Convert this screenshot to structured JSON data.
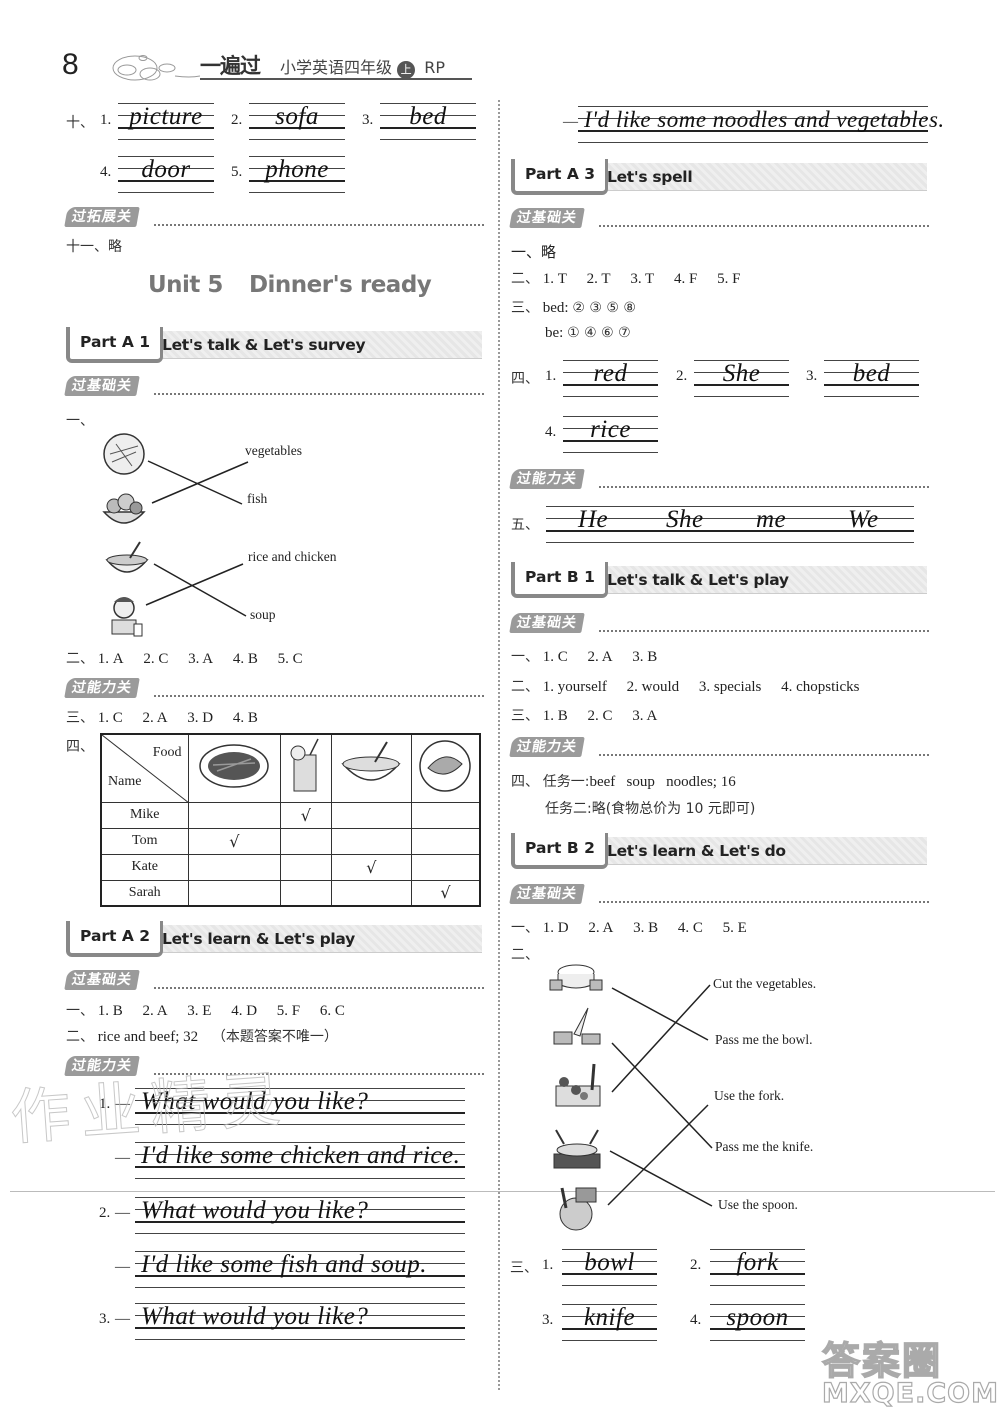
{
  "header": {
    "page_number": "8",
    "brand": "一遍过",
    "book_title": "小学英语四年级",
    "volume_badge": "上",
    "edition": "RP"
  },
  "left": {
    "q10": {
      "label": "十、",
      "items": [
        {
          "num": "1.",
          "word": "picture"
        },
        {
          "num": "2.",
          "word": "sofa"
        },
        {
          "num": "3.",
          "word": "bed"
        },
        {
          "num": "4.",
          "word": "door"
        },
        {
          "num": "5.",
          "word": "phone"
        }
      ]
    },
    "level_extend": "过拓展关",
    "q11": {
      "label": "十一、",
      "text": "略"
    },
    "unit_title": {
      "unit": "Unit 5",
      "name": "Dinner's ready"
    },
    "partA1": {
      "tab": "Part A 1",
      "title": "Let's talk & Let's survey",
      "level_basic": "过基础关",
      "q1_label": "一、",
      "match_pictures": [
        "fish-dish-picture",
        "vegetable-basket-picture",
        "soup-bowl-picture",
        "boy-eating-picture"
      ],
      "match_words": [
        "vegetables",
        "fish",
        "rice and chicken",
        "soup"
      ],
      "q2": {
        "label": "二、",
        "answers": [
          "1. A",
          "2. C",
          "3. A",
          "4. B",
          "5. C"
        ]
      },
      "level_ability": "过能力关",
      "q3": {
        "label": "三、",
        "answers": [
          "1. C",
          "2. A",
          "3. D",
          "4. B"
        ]
      },
      "q4": {
        "label": "四、",
        "corner_food": "Food",
        "corner_name": "Name",
        "food_pictures": [
          "noodles-plate-picture",
          "juice-glass-picture",
          "soup-bowl-picture",
          "fish-plate-picture"
        ],
        "rows": [
          {
            "name": "Mike",
            "checks": [
              "",
              "√",
              "",
              ""
            ]
          },
          {
            "name": "Tom",
            "checks": [
              "√",
              "",
              "",
              ""
            ]
          },
          {
            "name": "Kate",
            "checks": [
              "",
              "",
              "√",
              ""
            ]
          },
          {
            "name": "Sarah",
            "checks": [
              "",
              "",
              "",
              "√"
            ]
          }
        ]
      }
    },
    "partA2": {
      "tab": "Part A 2",
      "title": "Let's learn  & Let's play",
      "level_basic": "过基础关",
      "q1": {
        "label": "一、",
        "answers": [
          "1. B",
          "2. A",
          "3. E",
          "4. D",
          "5. F",
          "6. C"
        ]
      },
      "q2": {
        "label": "二、",
        "text": "rice and beef; 32",
        "note": "（本题答案不唯一）"
      },
      "level_ability": "过能力关",
      "dialogues": [
        {
          "num": "1.",
          "q": "What would you like?",
          "a": "I'd like some chicken and rice."
        },
        {
          "num": "2.",
          "q": "What would you like?",
          "a": "I'd like some fish and soup."
        },
        {
          "num": "3.",
          "q": "What would you like?",
          "a": "I'd like some noodles and vegetables."
        }
      ],
      "dash": "—"
    }
  },
  "right": {
    "partA3": {
      "tab": "Part A 3",
      "title": "Let's spell",
      "level_basic": "过基础关",
      "q1": {
        "label": "一、",
        "text": "略"
      },
      "q2": {
        "label": "二、",
        "answers": [
          "1. T",
          "2. T",
          "3. T",
          "4. F",
          "5. F"
        ]
      },
      "q3": {
        "label": "三、",
        "bed_label": "bed:",
        "bed_answers": "② ③ ⑤ ⑧",
        "be_label": "be:",
        "be_answers": "① ④ ⑥ ⑦"
      },
      "q4": {
        "label": "四、",
        "items": [
          {
            "num": "1.",
            "word": "red"
          },
          {
            "num": "2.",
            "word": "She"
          },
          {
            "num": "3.",
            "word": "bed"
          },
          {
            "num": "4.",
            "word": "rice"
          }
        ]
      },
      "level_ability": "过能力关",
      "q5": {
        "label": "五、",
        "words": [
          "He",
          "She",
          "me",
          "We"
        ]
      }
    },
    "partB1": {
      "tab": "Part B 1",
      "title": "Let's talk & Let's play",
      "level_basic": "过基础关",
      "q1": {
        "label": "一、",
        "answers": [
          "1. C",
          "2. A",
          "3. B"
        ]
      },
      "q2": {
        "label": "二、",
        "answers": [
          "1. yourself",
          "2. would",
          "3. specials",
          "4. chopsticks"
        ]
      },
      "q3": {
        "label": "三、",
        "answers": [
          "1. B",
          "2. C",
          "3. A"
        ]
      },
      "level_ability": "过能力关",
      "q4": {
        "label": "四、",
        "task1_label": "任务一:",
        "task1": "beef   soup   noodles; 16",
        "task2_label": "任务二:",
        "task2": "略(食物总价为 10 元即可)"
      }
    },
    "partB2": {
      "tab": "Part B 2",
      "title": "Let's learn  & Let's do",
      "level_basic": "过基础关",
      "q1": {
        "label": "一、",
        "answers": [
          "1. D",
          "2. A",
          "3. B",
          "4. C",
          "5. E"
        ]
      },
      "q2_label": "二、",
      "match_pictures": [
        "bowl-picture",
        "knife-picture",
        "cutting-vegetables-picture",
        "fork-picture",
        "spoon-picture"
      ],
      "match_phrases": [
        "Cut the vegetables.",
        "Pass me the bowl.",
        "Use the fork.",
        "Pass me the knife.",
        "Use the spoon."
      ],
      "q3": {
        "label": "三、",
        "items": [
          {
            "num": "1.",
            "word": "bowl"
          },
          {
            "num": "2.",
            "word": "fork"
          },
          {
            "num": "3.",
            "word": "knife"
          },
          {
            "num": "4.",
            "word": "spoon"
          }
        ]
      }
    }
  },
  "watermark": {
    "line1": "答案圈",
    "line2": "MXQE.COM",
    "stamp": "作业精灵"
  }
}
